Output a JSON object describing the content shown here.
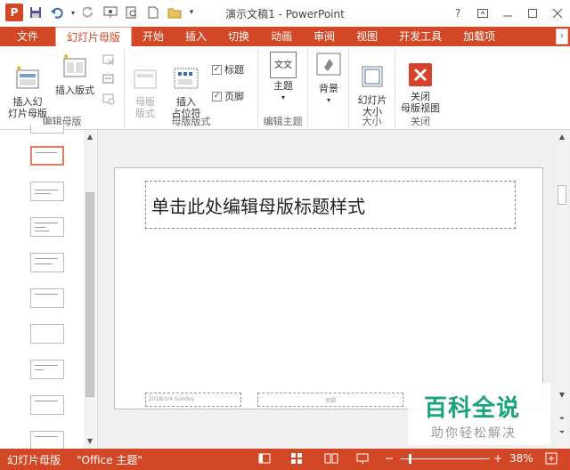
{
  "app": {
    "logo_letter": "P",
    "title": "演示文稿1 - PowerPoint",
    "help": "?",
    "accent": "#d24726"
  },
  "qat": [
    {
      "name": "save-icon",
      "glyph": "💾"
    },
    {
      "name": "undo-icon",
      "glyph": "↶"
    },
    {
      "name": "redo-icon",
      "glyph": "↻"
    },
    {
      "name": "present-icon",
      "glyph": "▣"
    },
    {
      "name": "preview-icon",
      "glyph": "🔍"
    },
    {
      "name": "new-icon",
      "glyph": "🗋"
    },
    {
      "name": "open-icon",
      "glyph": "📂"
    },
    {
      "name": "customize-icon",
      "glyph": "⏷"
    }
  ],
  "tabs": {
    "file": "文件",
    "items": [
      "幻灯片母版",
      "开始",
      "插入",
      "切换",
      "动画",
      "审阅",
      "视图",
      "开发工具",
      "加载项"
    ],
    "active_index": 0
  },
  "ribbon": {
    "group_edit_master": {
      "label": "编辑母版",
      "insert_master": "插入幻\n灯片母版",
      "insert_layout": "插入版式"
    },
    "group_master_layout": {
      "label": "母版版式",
      "master_layout": "母版\n版式",
      "insert_placeholder": "插入\n占位符",
      "title_check": "标题",
      "footer_check": "页脚"
    },
    "group_edit_theme": {
      "label": "编辑主题",
      "theme": "主题",
      "theme_icon_text": "文文"
    },
    "group_background": {
      "background": "背景"
    },
    "group_size": {
      "label": "大小",
      "slide_size": "幻灯片\n大小"
    },
    "group_close": {
      "label": "关闭",
      "close_master": "关闭\n母版视图"
    }
  },
  "slide": {
    "title_placeholder": "单击此处编辑母版标题样式",
    "footer_date": "2018/3/4 Sunday",
    "footer_text": "页脚"
  },
  "watermark": {
    "line1": "百科全说",
    "line2": "助你轻松解决"
  },
  "statusbar": {
    "view": "幻灯片母版",
    "theme": "\"Office 主题\"",
    "zoom_minus": "−",
    "zoom_plus": "+",
    "zoom": "38%"
  }
}
